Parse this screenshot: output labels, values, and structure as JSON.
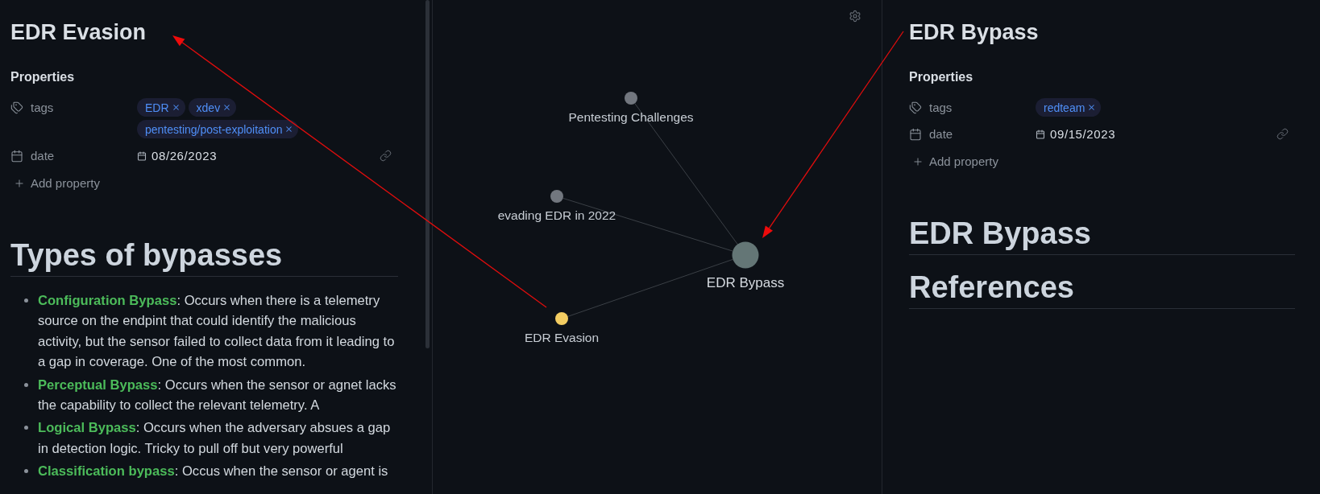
{
  "left_note": {
    "title": "EDR Evasion",
    "properties": {
      "heading": "Properties",
      "rows": [
        {
          "kind": "tags",
          "name": "tags",
          "tags": [
            "EDR",
            "xdev",
            "pentesting/post-exploitation"
          ]
        },
        {
          "kind": "date",
          "name": "date",
          "value": "08/26/2023"
        }
      ],
      "add_label": "Add property"
    },
    "body": [
      {
        "kind": "heading",
        "text": "Types of bypasses"
      },
      {
        "kind": "list",
        "items": [
          "**Configuration Bypass**: Occurs when there is a telemetry source on the endpint that could identify the malicious activity, but the sensor failed to collect data from it leading to a gap in coverage. One of the most common.",
          "**Perceptual Bypass**: Occurs when the sensor or agnet lacks the capability to collect the relevant telemetry. A",
          "**Logical Bypass**: Occurs when the adversary absues a gap in detection logic. Tricky to pull off but very powerful",
          "**Classification bypass**: Occus when the sensor or agent is"
        ]
      }
    ]
  },
  "graph": {
    "nodes": [
      {
        "label": "Pentesting Challenges",
        "kind": "note",
        "color": "#72777f"
      },
      {
        "label": "evading EDR in 2022",
        "kind": "note",
        "color": "#72777f"
      },
      {
        "label": "EDR Bypass",
        "kind": "hub",
        "color": "#647676"
      },
      {
        "label": "EDR Evasion",
        "kind": "note",
        "color": "#f3cd62"
      }
    ]
  },
  "right_note": {
    "title": "EDR Bypass",
    "properties": {
      "heading": "Properties",
      "rows": [
        {
          "kind": "tags",
          "name": "tags",
          "tags": [
            "redteam"
          ]
        },
        {
          "kind": "date",
          "name": "date",
          "value": "09/15/2023"
        }
      ],
      "add_label": "Add property"
    },
    "body": [
      {
        "kind": "heading",
        "text": "EDR Bypass"
      },
      {
        "kind": "heading",
        "text": "References"
      }
    ]
  }
}
